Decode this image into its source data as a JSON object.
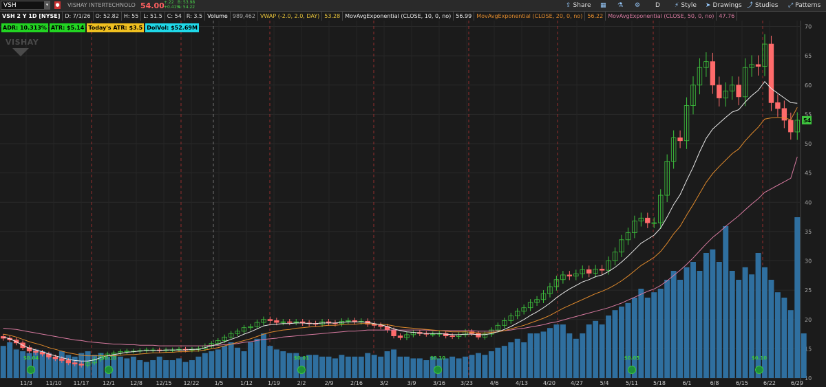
{
  "toolbar": {
    "symbol": "VSH",
    "company": "VISHAY INTERTECHNOLO",
    "last": "54.00",
    "change": "+.22",
    "change_pct": "+0.41%",
    "bid": "B: 53.98",
    "ask": "A: 54.22",
    "share": "Share",
    "d": "D",
    "style": "Style",
    "drawings": "Drawings",
    "studies": "Studies",
    "patterns": "Patterns"
  },
  "legend": {
    "title": "VSH 2 Y 1D [NYSE]",
    "date": "D: 7/1/26",
    "open": "O: 52.82",
    "high": "H: 55",
    "low": "L: 51.5",
    "close": "C: 54",
    "range": "R: 3.5",
    "volume_label": "Volume",
    "volume_value": "989,462",
    "vwap_label": "VWAP (-2.0, 2.0, DAY)",
    "vwap_value": "53.28",
    "ema10_label": "MovAvgExponential (CLOSE, 10, 0, no)",
    "ema10_value": "56.99",
    "ema20_label": "MovAvgExponential (CLOSE, 20, 0, no)",
    "ema20_value": "56.22",
    "ema50_label": "MovAvgExponential (CLOSE, 50, 0, no)",
    "ema50_value": "47.76"
  },
  "labels": {
    "adr": "ADR: 10.313%",
    "atr": "ATR: $5.14",
    "today_atr": "Today's ATR: $3.5",
    "dolvol": "DolVol: $52.69M"
  },
  "watermark": "VISHAY",
  "colors": {
    "up": "#3ec53e",
    "down": "#ff6b6b",
    "ema10": "#e8e8e8",
    "ema20": "#e08a2c",
    "ema50": "#d87aa0",
    "volume": "#2f6f9f",
    "divider": "#b33333",
    "price_tag": "#3ec53e"
  },
  "chart_data": {
    "type": "candlestick",
    "y_range": [
      10,
      71
    ],
    "y_ticks": [
      10,
      15,
      20,
      25,
      30,
      35,
      40,
      45,
      50,
      55,
      60,
      65,
      70
    ],
    "x_ticks": [
      "11/3",
      "11/10",
      "11/17",
      "12/1",
      "12/8",
      "12/15",
      "12/22",
      "1/5",
      "1/12",
      "1/19",
      "2/2",
      "2/9",
      "2/16",
      "3/2",
      "3/9",
      "3/16",
      "3/23",
      "4/6",
      "4/13",
      "4/20",
      "4/27",
      "5/4",
      "5/11",
      "5/18",
      "6/1",
      "6/8",
      "6/15",
      "6/22",
      "6/29"
    ],
    "last_price_tag": "54",
    "dividends": [
      {
        "label": "$0.04",
        "date": "11/5"
      },
      {
        "label": "$0.10",
        "date": "12/1"
      },
      {
        "label": "$0.01",
        "date": "2/2"
      },
      {
        "label": "$0.10",
        "date": "3/5"
      },
      {
        "label": "$0.05",
        "date": "5/11"
      },
      {
        "label": "$0.10",
        "date": "6/17"
      }
    ],
    "close": [
      16.8,
      16.5,
      16.0,
      15.2,
      14.6,
      14.4,
      14.1,
      13.6,
      13.3,
      13.0,
      12.6,
      12.4,
      12.2,
      12.6,
      13.2,
      13.8,
      14.1,
      14.3,
      14.5,
      14.6,
      14.6,
      14.7,
      14.8,
      14.8,
      14.7,
      14.8,
      14.8,
      14.9,
      14.8,
      14.9,
      15.0,
      15.5,
      15.9,
      16.4,
      17.0,
      17.6,
      18.0,
      18.6,
      18.8,
      19.5,
      20.0,
      19.8,
      19.5,
      19.6,
      19.5,
      19.6,
      19.4,
      19.3,
      19.2,
      19.6,
      19.4,
      19.3,
      19.7,
      19.8,
      19.6,
      19.7,
      19.2,
      19.0,
      18.8,
      18.2,
      17.2,
      16.9,
      17.4,
      17.8,
      17.6,
      17.5,
      17.5,
      17.6,
      17.2,
      17.1,
      17.4,
      17.9,
      17.6,
      17.0,
      17.5,
      18.2,
      19.0,
      19.8,
      20.6,
      21.4,
      22.0,
      22.9,
      23.4,
      24.4,
      25.6,
      26.8,
      27.6,
      27.4,
      27.8,
      28.5,
      27.9,
      28.6,
      28.4,
      30.0,
      31.5,
      33.6,
      34.8,
      36.8,
      37.3,
      36.5,
      36.5,
      41.2,
      47.0,
      51.0,
      50.5,
      56.5,
      60.0,
      63.0,
      64.0,
      60.0,
      57.8,
      59.0,
      60.0,
      58.0,
      63.0,
      63.5,
      63.2,
      67.0,
      57.0,
      56.0,
      54.0,
      52.0,
      54.0
    ],
    "ema10": [
      17.0,
      16.7,
      16.2,
      15.6,
      15.1,
      14.8,
      14.5,
      14.1,
      13.8,
      13.5,
      13.2,
      13.0,
      12.9,
      12.9,
      13.1,
      13.5,
      13.8,
      14.0,
      14.2,
      14.4,
      14.5,
      14.6,
      14.7,
      14.7,
      14.7,
      14.8,
      14.8,
      14.8,
      14.8,
      14.9,
      14.9,
      15.2,
      15.5,
      15.8,
      16.2,
      16.6,
      17.0,
      17.5,
      17.9,
      18.4,
      18.9,
      19.1,
      19.2,
      19.3,
      19.3,
      19.4,
      19.4,
      19.3,
      19.3,
      19.4,
      19.4,
      19.4,
      19.5,
      19.6,
      19.6,
      19.6,
      19.5,
      19.3,
      19.1,
      18.8,
      18.4,
      18.1,
      17.9,
      17.8,
      17.7,
      17.6,
      17.6,
      17.6,
      17.5,
      17.4,
      17.4,
      17.5,
      17.5,
      17.4,
      17.4,
      17.6,
      17.9,
      18.3,
      18.8,
      19.4,
      20.0,
      20.7,
      21.3,
      22.0,
      22.8,
      23.7,
      24.5,
      25.2,
      25.8,
      26.4,
      26.8,
      27.3,
      27.6,
      28.2,
      28.9,
      29.8,
      30.8,
      31.9,
      33.0,
      33.7,
      34.4,
      35.6,
      37.5,
      39.6,
      41.3,
      43.7,
      46.0,
      48.6,
      50.9,
      52.5,
      53.5,
      54.5,
      55.4,
      55.8,
      57.1,
      58.2,
      59.1,
      60.6,
      59.4,
      58.6,
      57.8,
      57.0,
      56.9
    ],
    "ema20": [
      17.5,
      17.3,
      17.0,
      16.6,
      16.2,
      15.9,
      15.6,
      15.2,
      14.9,
      14.6,
      14.3,
      14.1,
      13.9,
      13.8,
      13.8,
      13.8,
      13.8,
      13.8,
      13.9,
      14.0,
      14.0,
      14.1,
      14.2,
      14.3,
      14.3,
      14.4,
      14.4,
      14.5,
      14.5,
      14.6,
      14.6,
      14.8,
      15.0,
      15.2,
      15.5,
      15.8,
      16.1,
      16.4,
      16.7,
      17.1,
      17.5,
      17.8,
      18.0,
      18.2,
      18.3,
      18.5,
      18.6,
      18.7,
      18.8,
      18.9,
      19.0,
      19.0,
      19.1,
      19.2,
      19.2,
      19.3,
      19.3,
      19.2,
      19.2,
      19.1,
      18.9,
      18.7,
      18.6,
      18.5,
      18.4,
      18.3,
      18.2,
      18.1,
      18.0,
      17.9,
      17.9,
      17.9,
      17.8,
      17.7,
      17.7,
      17.8,
      17.9,
      18.1,
      18.4,
      18.7,
      19.0,
      19.4,
      19.8,
      20.2,
      20.7,
      21.3,
      21.9,
      22.4,
      22.9,
      23.4,
      23.9,
      24.4,
      24.8,
      25.3,
      25.9,
      26.6,
      27.4,
      28.3,
      29.2,
      29.9,
      30.6,
      31.6,
      33.0,
      34.6,
      35.9,
      37.8,
      39.6,
      41.5,
      43.4,
      44.9,
      46.1,
      47.2,
      48.3,
      49.1,
      50.5,
      51.7,
      52.8,
      54.2,
      54.4,
      54.5,
      54.4,
      54.1,
      56.2
    ],
    "ema50": [
      18.5,
      18.4,
      18.3,
      18.1,
      17.9,
      17.7,
      17.5,
      17.3,
      17.1,
      16.9,
      16.7,
      16.5,
      16.4,
      16.2,
      16.1,
      16.0,
      15.9,
      15.8,
      15.8,
      15.7,
      15.7,
      15.6,
      15.6,
      15.6,
      15.5,
      15.5,
      15.5,
      15.5,
      15.5,
      15.5,
      15.5,
      15.5,
      15.6,
      15.6,
      15.7,
      15.8,
      15.9,
      16.1,
      16.2,
      16.4,
      16.6,
      16.7,
      16.8,
      17.0,
      17.1,
      17.2,
      17.3,
      17.4,
      17.5,
      17.6,
      17.7,
      17.8,
      17.9,
      18.0,
      18.0,
      18.1,
      18.2,
      18.2,
      18.2,
      18.2,
      18.2,
      18.2,
      18.2,
      18.2,
      18.2,
      18.2,
      18.1,
      18.1,
      18.1,
      18.1,
      18.1,
      18.1,
      18.1,
      18.0,
      18.0,
      18.0,
      18.1,
      18.1,
      18.2,
      18.4,
      18.5,
      18.7,
      18.9,
      19.1,
      19.4,
      19.6,
      19.9,
      20.2,
      20.5,
      20.8,
      21.1,
      21.4,
      21.7,
      22.0,
      22.4,
      22.8,
      23.3,
      23.8,
      24.3,
      24.8,
      25.2,
      25.8,
      26.6,
      27.5,
      28.4,
      29.4,
      30.5,
      31.7,
      32.9,
      34.0,
      34.9,
      35.9,
      36.8,
      37.7,
      38.7,
      39.7,
      40.6,
      41.7,
      42.3,
      42.9,
      43.5,
      44.1,
      47.76
    ],
    "volume": [
      0.18,
      0.2,
      0.16,
      0.15,
      0.14,
      0.16,
      0.15,
      0.14,
      0.12,
      0.15,
      0.13,
      0.12,
      0.14,
      0.15,
      0.13,
      0.14,
      0.12,
      0.13,
      0.12,
      0.11,
      0.12,
      0.1,
      0.09,
      0.1,
      0.12,
      0.1,
      0.1,
      0.11,
      0.09,
      0.1,
      0.12,
      0.14,
      0.15,
      0.16,
      0.18,
      0.2,
      0.17,
      0.15,
      0.2,
      0.22,
      0.25,
      0.18,
      0.16,
      0.15,
      0.14,
      0.14,
      0.12,
      0.13,
      0.13,
      0.12,
      0.12,
      0.11,
      0.13,
      0.12,
      0.12,
      0.12,
      0.14,
      0.13,
      0.12,
      0.15,
      0.16,
      0.12,
      0.12,
      0.11,
      0.11,
      0.1,
      0.12,
      0.11,
      0.11,
      0.12,
      0.11,
      0.12,
      0.13,
      0.14,
      0.13,
      0.15,
      0.17,
      0.18,
      0.2,
      0.22,
      0.2,
      0.25,
      0.25,
      0.26,
      0.28,
      0.3,
      0.3,
      0.25,
      0.22,
      0.25,
      0.3,
      0.32,
      0.3,
      0.35,
      0.38,
      0.4,
      0.42,
      0.45,
      0.5,
      0.45,
      0.48,
      0.5,
      0.55,
      0.6,
      0.55,
      0.62,
      0.65,
      0.6,
      0.7,
      0.72,
      0.65,
      0.85,
      0.6,
      0.55,
      0.62,
      0.58,
      0.7,
      0.62,
      0.55,
      0.48,
      0.45,
      0.38,
      0.9,
      0.25
    ]
  }
}
